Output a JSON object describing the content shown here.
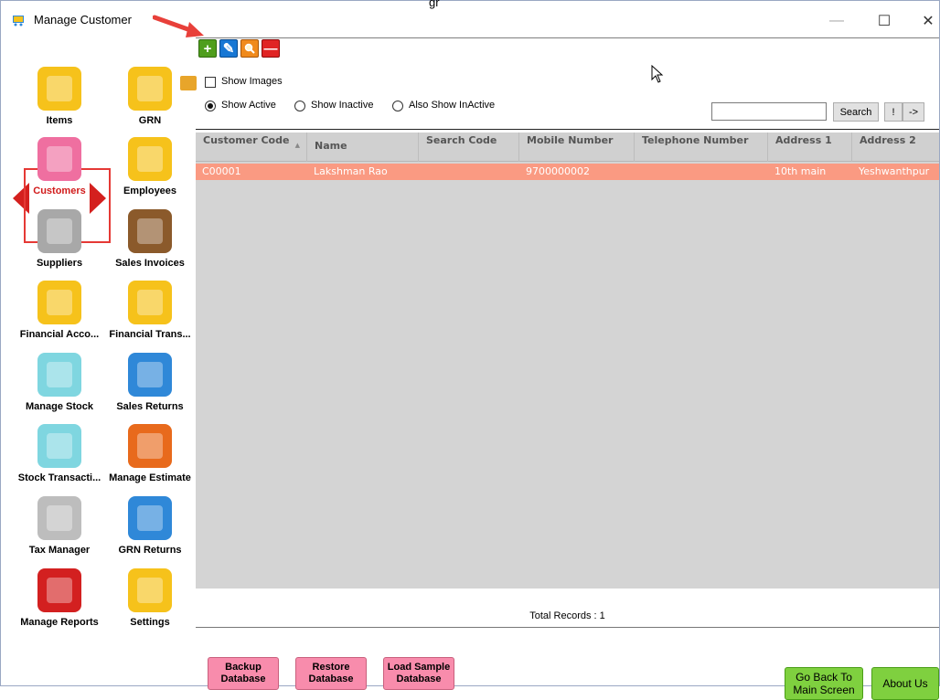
{
  "window": {
    "title": "Manage Customer",
    "bg_title": "gr",
    "minimize": "—",
    "maximize": "☐",
    "close": "✕"
  },
  "nav": {
    "items": [
      {
        "label": "Items",
        "icon": "cart-icon",
        "color": "#f6c21b"
      },
      {
        "label": "GRN",
        "icon": "truck-icon",
        "color": "#f6c21b"
      },
      {
        "label": "Customers",
        "icon": "customers-icon",
        "color": "#ef6fa0"
      },
      {
        "label": "Employees",
        "icon": "employee-icon",
        "color": "#f6c21b"
      },
      {
        "label": "Suppliers",
        "icon": "factory-icon",
        "color": "#a8a8a8"
      },
      {
        "label": "Sales Invoices",
        "icon": "invoice-icon",
        "color": "#8b5a2b"
      },
      {
        "label": "Financial Acco...",
        "icon": "coins-icon",
        "color": "#f6c21b"
      },
      {
        "label": "Financial Trans...",
        "icon": "coins-transfer-icon",
        "color": "#f6c21b"
      },
      {
        "label": "Manage Stock",
        "icon": "stock-icon",
        "color": "#7fd6e0"
      },
      {
        "label": "Sales Returns",
        "icon": "return-cart-icon",
        "color": "#2f88d8"
      },
      {
        "label": "Stock Transacti...",
        "icon": "stock-transfer-icon",
        "color": "#7fd6e0"
      },
      {
        "label": "Manage Estimate",
        "icon": "estimate-icon",
        "color": "#e86a1c"
      },
      {
        "label": "Tax Manager",
        "icon": "percent-icon",
        "color": "#bdbdbd"
      },
      {
        "label": "GRN Returns",
        "icon": "truck-return-icon",
        "color": "#2f88d8"
      },
      {
        "label": "Manage Reports",
        "icon": "reports-icon",
        "color": "#d32020"
      },
      {
        "label": "Settings",
        "icon": "tools-icon",
        "color": "#f6c21b"
      }
    ],
    "active": "Customers"
  },
  "toolbar": {
    "add": "+",
    "edit": "✎",
    "search": "⚲",
    "delete": "—"
  },
  "filters": {
    "show_images": "Show Images",
    "show_active": "Show Active",
    "show_inactive": "Show Inactive",
    "also_show_inactive": "Also Show InActive",
    "selected": "Show Active"
  },
  "search": {
    "value": "",
    "button": "Search",
    "bang": "!",
    "go": "->"
  },
  "grid": {
    "columns": [
      "Customer Code",
      "Name",
      "Search Code",
      "Mobile Number",
      "Telephone Number",
      "Address 1",
      "Address 2"
    ],
    "rows": [
      [
        "C00001",
        "Lakshman Rao",
        "",
        "9700000002",
        "",
        "10th main",
        "Yeshwanthpur"
      ]
    ],
    "row_color": "#fa9a82"
  },
  "scroll": {
    "left": "<",
    "right": ">"
  },
  "footer": {
    "total": "Total Records : 1",
    "backup": "Backup Database",
    "restore": "Restore Database",
    "load_sample": "Load Sample Database",
    "go_back": "Go Back To Main Screen",
    "about": "About Us"
  }
}
